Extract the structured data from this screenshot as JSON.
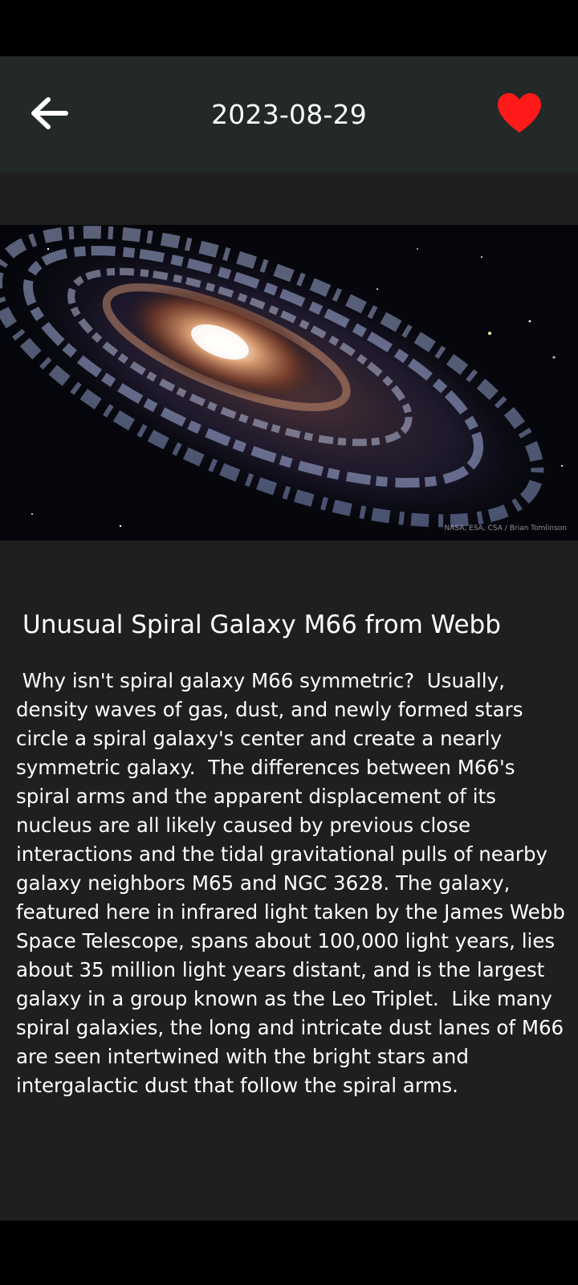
{
  "app_bar": {
    "title": "2023-08-29",
    "back_icon": "arrow-left-icon",
    "favorite_icon": "heart-icon",
    "favorite_color": "#ff1a1a"
  },
  "image": {
    "credit": "NASA, ESA, CSA / Brian Tomlinson"
  },
  "article": {
    "title": "Unusual Spiral Galaxy M66 from Webb",
    "body": " Why isn't spiral galaxy M66 symmetric?  Usually, density waves of gas, dust, and newly formed stars circle a spiral galaxy's center and create a nearly symmetric galaxy.  The differences between M66's spiral arms and the apparent displacement of its nucleus are all likely caused by previous close interactions and the tidal gravitational pulls of nearby galaxy neighbors M65 and NGC 3628. The galaxy, featured here in infrared light taken by the James Webb Space Telescope, spans about 100,000 light years, lies about 35 million light years distant, and is the largest galaxy in a group known as the Leo Triplet.  Like many spiral galaxies, the long and intricate dust lanes of M66 are seen intertwined with the bright stars and intergalactic dust that follow the spiral arms."
  }
}
